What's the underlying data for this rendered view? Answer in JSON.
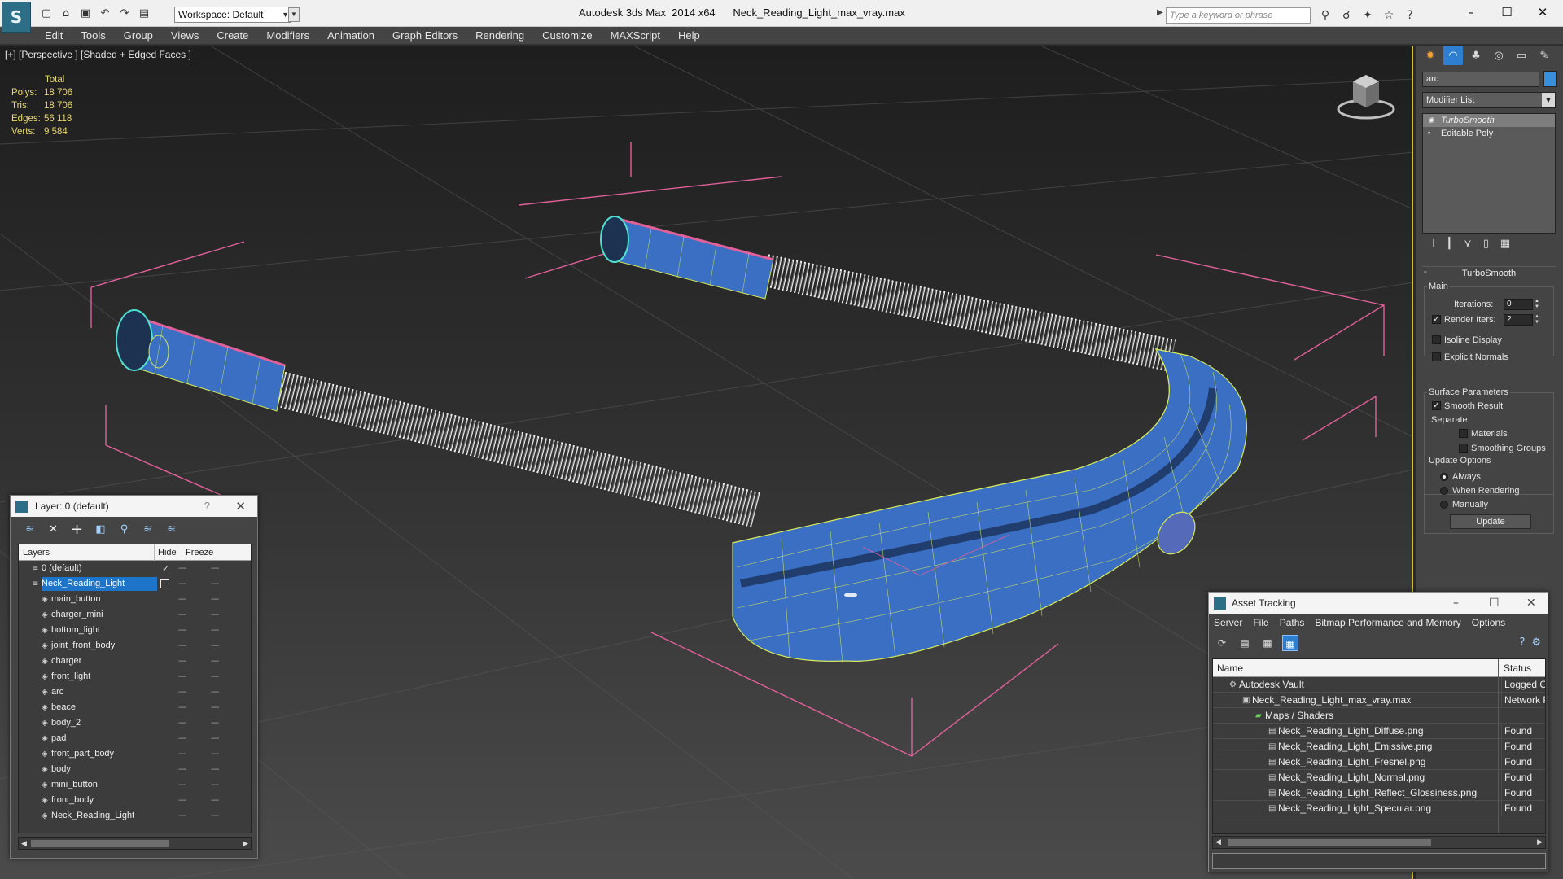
{
  "window": {
    "title": "Autodesk 3ds Max  2014 x64      Neck_Reading_Light_max_vray.max",
    "workspace": "Workspace: Default",
    "search_placeholder": "Type a keyword or phrase"
  },
  "menu": [
    "Edit",
    "Tools",
    "Group",
    "Views",
    "Create",
    "Modifiers",
    "Animation",
    "Graph Editors",
    "Rendering",
    "Customize",
    "MAXScript",
    "Help"
  ],
  "viewport": {
    "label": "[+] [Perspective ] [Shaded + Edged Faces ]",
    "stats": {
      "header": "Total",
      "polys_label": "Polys:",
      "polys": "18 706",
      "tris_label": "Tris:",
      "tris": "18 706",
      "edges_label": "Edges:",
      "edges": "56 118",
      "verts_label": "Verts:",
      "verts": "9 584"
    },
    "colors": {
      "mesh": "#3a6fc4",
      "wire": "#d4e85a",
      "bbox": "#e0609a",
      "selection_border": "#d8c020"
    }
  },
  "command_panel": {
    "object_name": "arc",
    "object_color": "#3a8fd8",
    "modifier_list": "Modifier List",
    "stack": [
      "TurboSmooth",
      "Editable Poly"
    ],
    "rollout_title": "TurboSmooth",
    "main_group": "Main",
    "iterations_label": "Iterations:",
    "iterations_value": "0",
    "render_iters_label": "Render Iters:",
    "render_iters_value": "2",
    "isoline_label": "Isoline Display",
    "explicit_normals_label": "Explicit Normals",
    "surface_group": "Surface Parameters",
    "smooth_result_label": "Smooth Result",
    "separate_label": "Separate",
    "materials_label": "Materials",
    "smoothing_groups_label": "Smoothing Groups",
    "update_group": "Update Options",
    "always_label": "Always",
    "when_rendering_label": "When Rendering",
    "manually_label": "Manually",
    "update_button": "Update"
  },
  "layer_dialog": {
    "title": "Layer: 0 (default)",
    "help": "?",
    "col_layers": "Layers",
    "col_hide": "Hide",
    "col_freeze": "Freeze",
    "rows": [
      {
        "name": "0 (default)",
        "level": 0
      },
      {
        "name": "Neck_Reading_Light",
        "level": 0
      },
      {
        "name": "main_button",
        "level": 1
      },
      {
        "name": "charger_mini",
        "level": 1
      },
      {
        "name": "bottom_light",
        "level": 1
      },
      {
        "name": "joint_front_body",
        "level": 1
      },
      {
        "name": "charger",
        "level": 1
      },
      {
        "name": "front_light",
        "level": 1
      },
      {
        "name": "arc",
        "level": 1
      },
      {
        "name": "beace",
        "level": 1
      },
      {
        "name": "body_2",
        "level": 1
      },
      {
        "name": "pad",
        "level": 1
      },
      {
        "name": "front_part_body",
        "level": 1
      },
      {
        "name": "body",
        "level": 1
      },
      {
        "name": "mini_button",
        "level": 1
      },
      {
        "name": "front_body",
        "level": 1
      },
      {
        "name": "Neck_Reading_Light",
        "level": 1
      }
    ]
  },
  "asset_tracking": {
    "title": "Asset Tracking",
    "menu": [
      "Server",
      "File",
      "Paths",
      "Bitmap Performance and Memory",
      "Options"
    ],
    "col_name": "Name",
    "col_status": "Status",
    "rows": [
      {
        "name": "Autodesk Vault",
        "status": "Logged Ou",
        "level": 0
      },
      {
        "name": "Neck_Reading_Light_max_vray.max",
        "status": "Network P",
        "level": 1
      },
      {
        "name": "Maps / Shaders",
        "status": "",
        "level": 2
      },
      {
        "name": "Neck_Reading_Light_Diffuse.png",
        "status": "Found",
        "level": 3
      },
      {
        "name": "Neck_Reading_Light_Emissive.png",
        "status": "Found",
        "level": 3
      },
      {
        "name": "Neck_Reading_Light_Fresnel.png",
        "status": "Found",
        "level": 3
      },
      {
        "name": "Neck_Reading_Light_Normal.png",
        "status": "Found",
        "level": 3
      },
      {
        "name": "Neck_Reading_Light_Reflect_Glossiness.png",
        "status": "Found",
        "level": 3
      },
      {
        "name": "Neck_Reading_Light_Specular.png",
        "status": "Found",
        "level": 3
      }
    ]
  }
}
